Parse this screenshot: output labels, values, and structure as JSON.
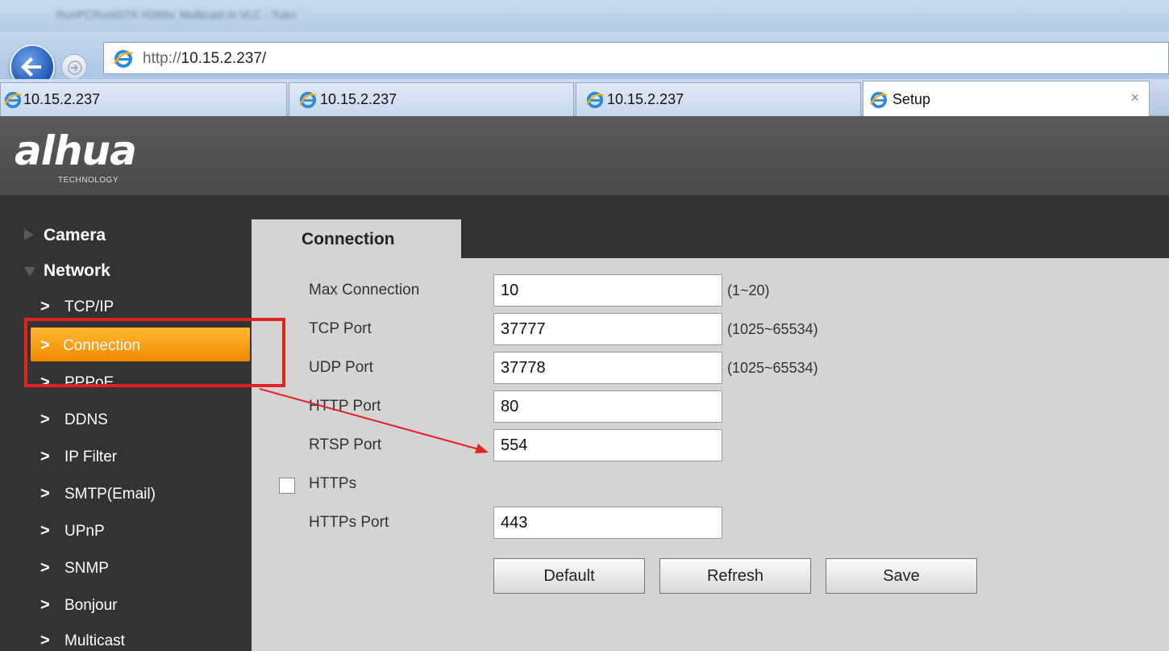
{
  "browser": {
    "window_title": "RunPCRuntSTK H265v, Multicast in VLC - Tuev",
    "address": {
      "scheme": "http://",
      "host": "10.15.2.237/"
    },
    "tabs": [
      {
        "label": "10.15.2.237"
      },
      {
        "label": "10.15.2.237"
      },
      {
        "label": "10.15.2.237"
      },
      {
        "label": "Setup",
        "active": true,
        "close": "×"
      }
    ]
  },
  "header": {
    "logo_text": "alhua",
    "logo_subtext": "TECHNOLOGY"
  },
  "sidebar": {
    "groups": [
      {
        "label": "Camera",
        "expanded": false
      },
      {
        "label": "Network",
        "expanded": true
      }
    ],
    "chevron": ">",
    "items": [
      {
        "label": "TCP/IP"
      },
      {
        "label": "Connection",
        "selected": true
      },
      {
        "label": "PPPoE"
      },
      {
        "label": "DDNS"
      },
      {
        "label": "IP Filter"
      },
      {
        "label": "SMTP(Email)"
      },
      {
        "label": "UPnP"
      },
      {
        "label": "SNMP"
      },
      {
        "label": "Bonjour"
      },
      {
        "label": "Multicast"
      }
    ]
  },
  "content": {
    "tab_title": "Connection",
    "fields": {
      "max_connection": {
        "label": "Max Connection",
        "value": "10",
        "hint": "(1~20)"
      },
      "tcp_port": {
        "label": "TCP Port",
        "value": "37777",
        "hint": "(1025~65534)"
      },
      "udp_port": {
        "label": "UDP Port",
        "value": "37778",
        "hint": "(1025~65534)"
      },
      "http_port": {
        "label": "HTTP Port",
        "value": "80"
      },
      "rtsp_port": {
        "label": "RTSP Port",
        "value": "554"
      },
      "https": {
        "label": "HTTPs",
        "checked": false
      },
      "https_port": {
        "label": "HTTPs Port",
        "value": "443"
      }
    },
    "buttons": {
      "default": "Default",
      "refresh": "Refresh",
      "save": "Save"
    }
  },
  "colors": {
    "sidebar_bg": "#333333",
    "header_bg": "#555555",
    "content_bg": "#d4d4d4",
    "selected_start": "#ffb733",
    "selected_end": "#f28a00",
    "annotation": "#e32222"
  }
}
